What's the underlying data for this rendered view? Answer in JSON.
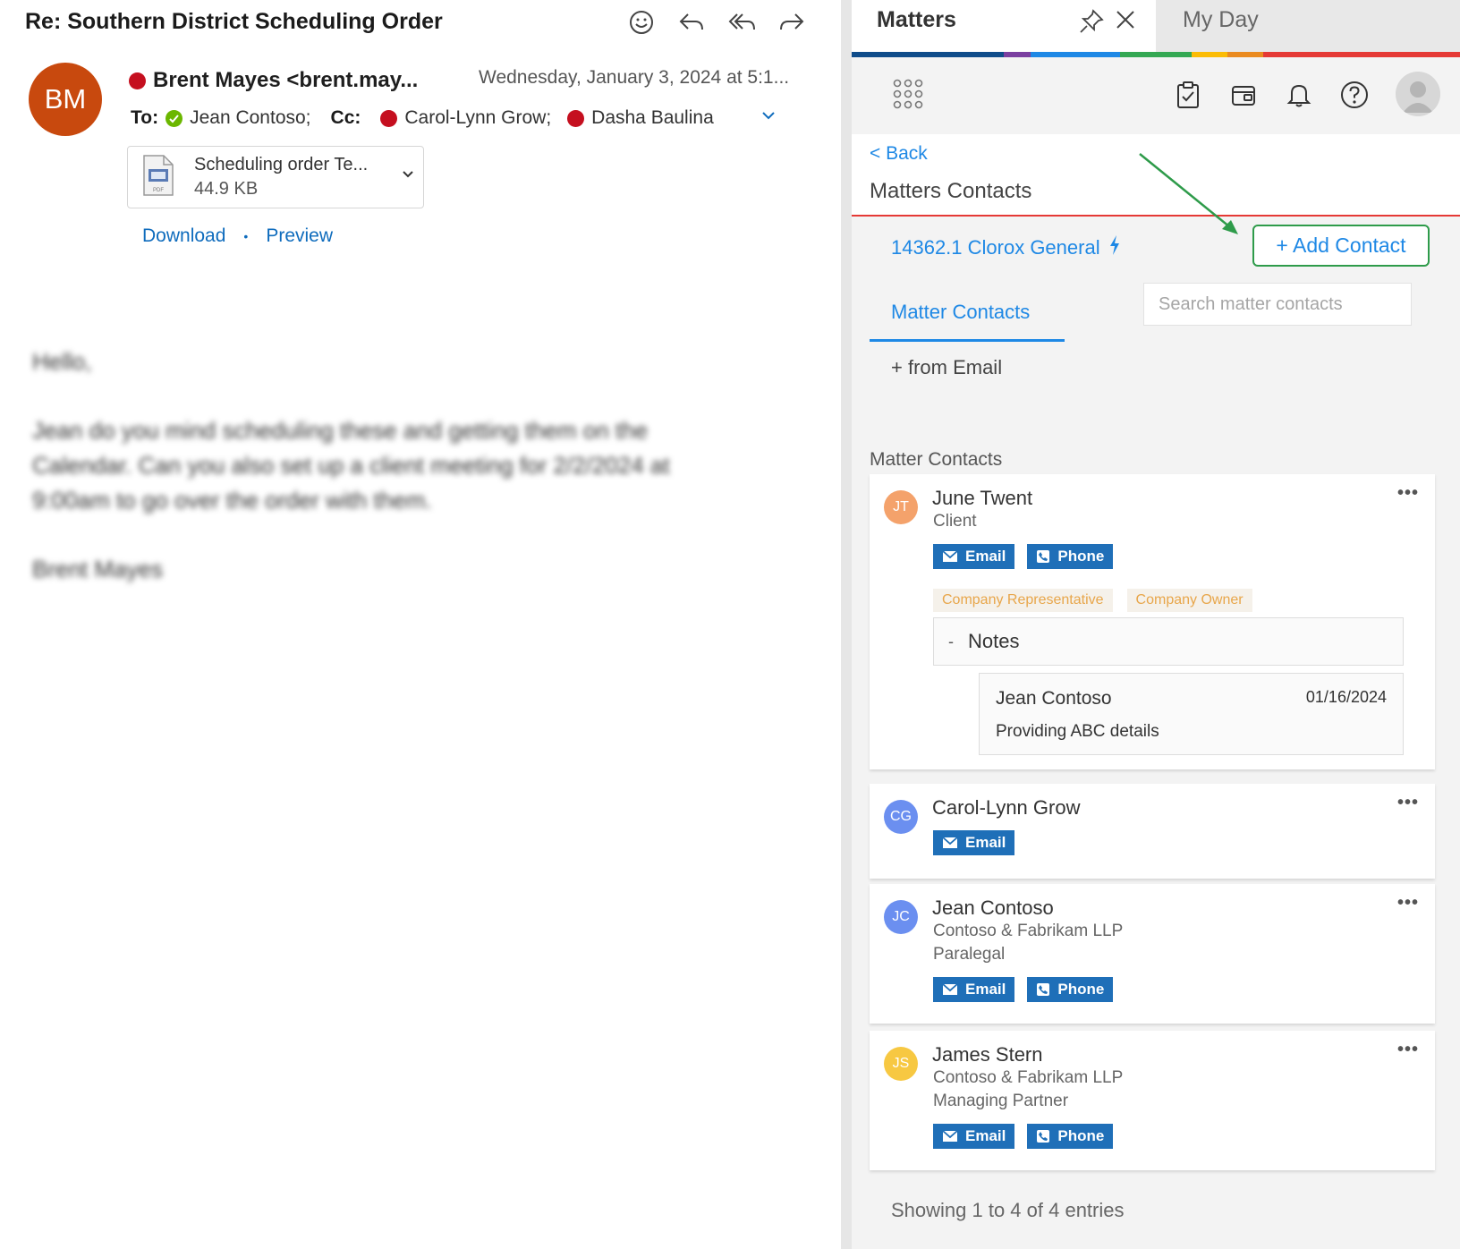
{
  "email": {
    "subject": "Re: Southern District Scheduling Order",
    "avatar_initials": "BM",
    "sender": "Brent Mayes <brent.may...",
    "datetime": "Wednesday, January 3, 2024 at 5:1...",
    "to_label": "To:",
    "to": "Jean Contoso;",
    "cc_label": "Cc:",
    "cc": [
      "Carol-Lynn Grow;",
      "Dasha Baulina"
    ],
    "attachment": {
      "name": "Scheduling order Te...",
      "size": "44.9 KB",
      "type_label": "PDF"
    },
    "download_label": "Download",
    "preview_label": "Preview",
    "separator": "•",
    "body": {
      "greeting": "Hello,",
      "paragraph": "Jean do you mind scheduling these and getting them on the Calendar. Can you also set up a client meeting for 2/2/2024 at 9:00am to go over the order with them.",
      "signature": "Brent Mayes"
    }
  },
  "panel": {
    "tab_matters": "Matters",
    "tab_myday": "My Day",
    "rainbow_colors": [
      "#0f4c8a",
      "#7b3fa0",
      "#1e88e5",
      "#34a853",
      "#fbbc05",
      "#ea8a1f",
      "#e53935"
    ],
    "back": "< Back",
    "title": "Matters Contacts",
    "matter": "14362.1 Clorox General",
    "add_contact": "+ Add Contact",
    "tab_contacts": "Matter Contacts",
    "search_placeholder": "Search matter contacts",
    "from_email": "+ from Email",
    "section_label": "Matter Contacts",
    "email_btn": "Email",
    "phone_btn": "Phone",
    "more": "•••",
    "contacts": [
      {
        "initials": "JT",
        "name": "June Twent",
        "color": "#f4a26b",
        "lines": [
          "Client"
        ],
        "tags": [
          "Company Representative",
          "Company Owner"
        ],
        "notes_label": "Notes",
        "notes_toggle": "-",
        "note": {
          "author": "Jean Contoso",
          "date": "01/16/2024",
          "text": "Providing ABC details"
        }
      },
      {
        "initials": "CG",
        "name": "Carol-Lynn Grow",
        "color": "#6b8ff0",
        "lines": []
      },
      {
        "initials": "JC",
        "name": "Jean Contoso",
        "color": "#6b8ff0",
        "lines": [
          "Contoso & Fabrikam LLP",
          "Paralegal"
        ]
      },
      {
        "initials": "JS",
        "name": "James Stern",
        "color": "#f7c842",
        "lines": [
          "Contoso & Fabrikam LLP",
          "Managing Partner"
        ]
      }
    ],
    "showing": "Showing 1 to 4 of 4 entries",
    "annotation_color": "#2e9b4a"
  }
}
